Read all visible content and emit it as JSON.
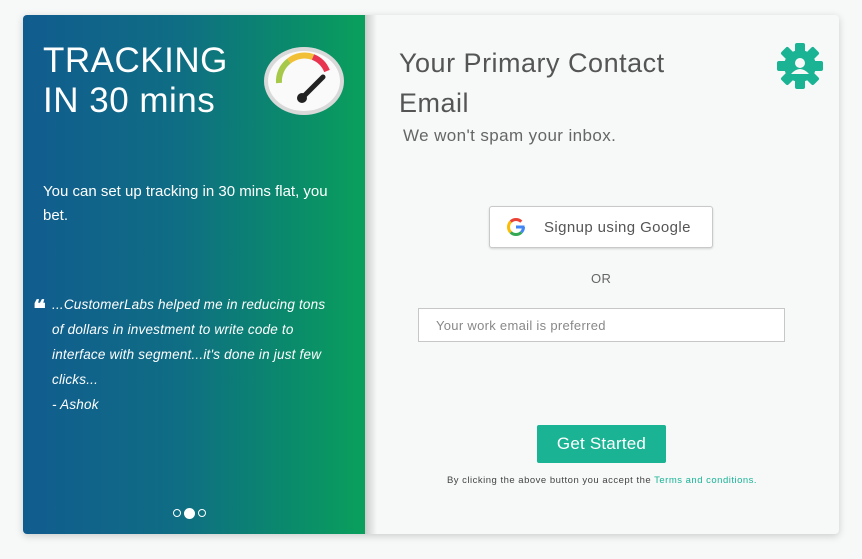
{
  "promo": {
    "headline": "TRACKING IN 30 mins",
    "subtext": "You can set up tracking in 30 mins flat, you bet.",
    "quote_mark": "❝",
    "quote": "...CustomerLabs helped me in reducing tons of dollars in investment to write code to interface with segment...it's done in just few clicks...",
    "author": "- Ashok",
    "gauge_icon": "speedometer-icon",
    "slides": {
      "count": 3,
      "active_index": 1
    }
  },
  "form": {
    "title": "Your Primary Contact Email",
    "tagline": "We won't spam your inbox.",
    "google_button_label": "Signup using Google",
    "divider": "OR",
    "email_placeholder": "Your work email is preferred",
    "email_value": "",
    "submit_label": "Get Started",
    "terms_prefix": "By clicking the above button you accept the ",
    "terms_link": "Terms and conditions."
  },
  "colors": {
    "accent": "#1ab394",
    "gradient_start": "#115c8f",
    "gradient_end": "#0aa05c"
  }
}
